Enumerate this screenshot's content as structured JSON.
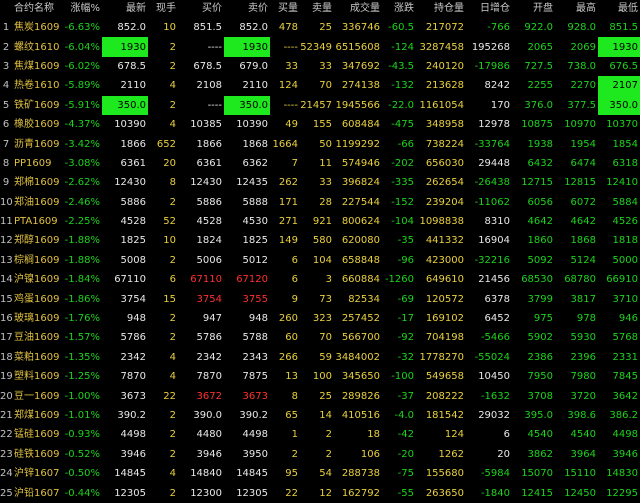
{
  "columns": [
    "",
    "合约名称",
    "涨幅%",
    "最新",
    "现手",
    "买价",
    "卖价",
    "买量",
    "卖量",
    "成交量",
    "涨跌",
    "持仓量",
    "日增仓",
    "开盘",
    "最高",
    "最低"
  ],
  "rows": [
    [
      "1",
      "焦炭1609",
      "-6.63%",
      "852.0",
      "10",
      "851.5",
      "852.0",
      "478",
      "25",
      "336746",
      "-60.5",
      "217072",
      "-766",
      "922.0",
      "928.0",
      "851.5"
    ],
    [
      "2",
      "螺纹1610",
      "-6.04%",
      "1930",
      "2",
      "----",
      "1930",
      "----",
      "52349",
      "6515608",
      "-124",
      "3287458",
      "195268",
      "2065",
      "2069",
      "1930"
    ],
    [
      "3",
      "焦煤1609",
      "-6.02%",
      "678.5",
      "2",
      "678.5",
      "679.0",
      "33",
      "33",
      "347692",
      "-43.5",
      "240120",
      "-17986",
      "727.5",
      "738.0",
      "676.5"
    ],
    [
      "4",
      "热卷1610",
      "-5.89%",
      "2110",
      "4",
      "2108",
      "2110",
      "124",
      "70",
      "274138",
      "-132",
      "213628",
      "8242",
      "2255",
      "2270",
      "2107"
    ],
    [
      "5",
      "铁矿1609",
      "-5.91%",
      "350.0",
      "2",
      "----",
      "350.0",
      "----",
      "21457",
      "1945566",
      "-22.0",
      "1161054",
      "170",
      "376.0",
      "377.5",
      "350.0"
    ],
    [
      "6",
      "橡胶1609",
      "-4.37%",
      "10390",
      "4",
      "10385",
      "10390",
      "49",
      "155",
      "608484",
      "-475",
      "348958",
      "12978",
      "10875",
      "10970",
      "10370"
    ],
    [
      "7",
      "沥青1609",
      "-3.42%",
      "1866",
      "652",
      "1866",
      "1868",
      "1664",
      "50",
      "1199292",
      "-66",
      "738224",
      "-33764",
      "1938",
      "1954",
      "1854"
    ],
    [
      "8",
      "PP1609",
      "-3.08%",
      "6361",
      "20",
      "6361",
      "6362",
      "7",
      "11",
      "574946",
      "-202",
      "656030",
      "29448",
      "6432",
      "6474",
      "6318"
    ],
    [
      "9",
      "郑棉1609",
      "-2.62%",
      "12430",
      "8",
      "12430",
      "12435",
      "262",
      "33",
      "396824",
      "-335",
      "262654",
      "-26438",
      "12715",
      "12815",
      "12410"
    ],
    [
      "10",
      "郑油1609",
      "-2.46%",
      "5886",
      "2",
      "5886",
      "5888",
      "171",
      "28",
      "227544",
      "-152",
      "239204",
      "-11062",
      "6056",
      "6072",
      "5884"
    ],
    [
      "11",
      "PTA1609",
      "-2.25%",
      "4528",
      "52",
      "4528",
      "4530",
      "271",
      "921",
      "800624",
      "-104",
      "1098838",
      "8310",
      "4642",
      "4642",
      "4526"
    ],
    [
      "12",
      "郑醇1609",
      "-1.88%",
      "1825",
      "10",
      "1824",
      "1825",
      "149",
      "580",
      "620080",
      "-35",
      "441332",
      "16904",
      "1860",
      "1868",
      "1818"
    ],
    [
      "13",
      "棕榈1609",
      "-1.88%",
      "5008",
      "2",
      "5006",
      "5012",
      "6",
      "104",
      "658848",
      "-96",
      "423000",
      "-32216",
      "5092",
      "5124",
      "5000"
    ],
    [
      "14",
      "沪镍1609",
      "-1.84%",
      "67110",
      "6",
      "67110",
      "67120",
      "6",
      "3",
      "660884",
      "-1260",
      "649610",
      "21456",
      "68530",
      "68780",
      "66910"
    ],
    [
      "15",
      "鸡蛋1609",
      "-1.86%",
      "3754",
      "15",
      "3754",
      "3755",
      "9",
      "73",
      "82534",
      "-69",
      "120572",
      "6378",
      "3799",
      "3817",
      "3710"
    ],
    [
      "16",
      "玻璃1609",
      "-1.76%",
      "948",
      "2",
      "947",
      "948",
      "260",
      "323",
      "257452",
      "-17",
      "169102",
      "6452",
      "975",
      "978",
      "946"
    ],
    [
      "17",
      "豆油1609",
      "-1.57%",
      "5786",
      "2",
      "5786",
      "5788",
      "60",
      "70",
      "566700",
      "-92",
      "704198",
      "-5466",
      "5902",
      "5930",
      "5768"
    ],
    [
      "18",
      "菜粕1609",
      "-1.35%",
      "2342",
      "4",
      "2342",
      "2343",
      "266",
      "59",
      "3484002",
      "-32",
      "1778270",
      "-55024",
      "2386",
      "2396",
      "2331"
    ],
    [
      "19",
      "塑料1609",
      "-1.25%",
      "7870",
      "4",
      "7870",
      "7875",
      "13",
      "100",
      "345650",
      "-100",
      "549658",
      "10450",
      "7950",
      "7980",
      "7845"
    ],
    [
      "20",
      "豆一1609",
      "-1.00%",
      "3673",
      "22",
      "3672",
      "3673",
      "8",
      "25",
      "289826",
      "-37",
      "208222",
      "-1632",
      "3708",
      "3720",
      "3642"
    ],
    [
      "21",
      "郑煤1609",
      "-1.01%",
      "390.2",
      "2",
      "390.0",
      "390.2",
      "65",
      "14",
      "410516",
      "-4.0",
      "181542",
      "29032",
      "395.0",
      "398.6",
      "386.2"
    ],
    [
      "22",
      "锰硅1609",
      "-0.93%",
      "4498",
      "2",
      "4480",
      "4498",
      "1",
      "2",
      "18",
      "-42",
      "124",
      "6",
      "4540",
      "4540",
      "4498"
    ],
    [
      "23",
      "硅铁1609",
      "-0.52%",
      "3946",
      "2",
      "3946",
      "3950",
      "2",
      "2",
      "106",
      "-20",
      "1262",
      "20",
      "3862",
      "3964",
      "3946"
    ],
    [
      "24",
      "沪锌1607",
      "-0.50%",
      "14845",
      "4",
      "14840",
      "14845",
      "95",
      "54",
      "288738",
      "-75",
      "155680",
      "-5984",
      "15070",
      "15110",
      "14830"
    ],
    [
      "25",
      "沪铅1607",
      "-0.44%",
      "12305",
      "2",
      "12300",
      "12305",
      "22",
      "12",
      "162792",
      "-55",
      "263650",
      "-1840",
      "12415",
      "12450",
      "12295"
    ]
  ],
  "colors": {
    "down": "#1ed21e",
    "up": "#ff3030",
    "highlight": "#1ee81e",
    "name": "#e0c040"
  }
}
